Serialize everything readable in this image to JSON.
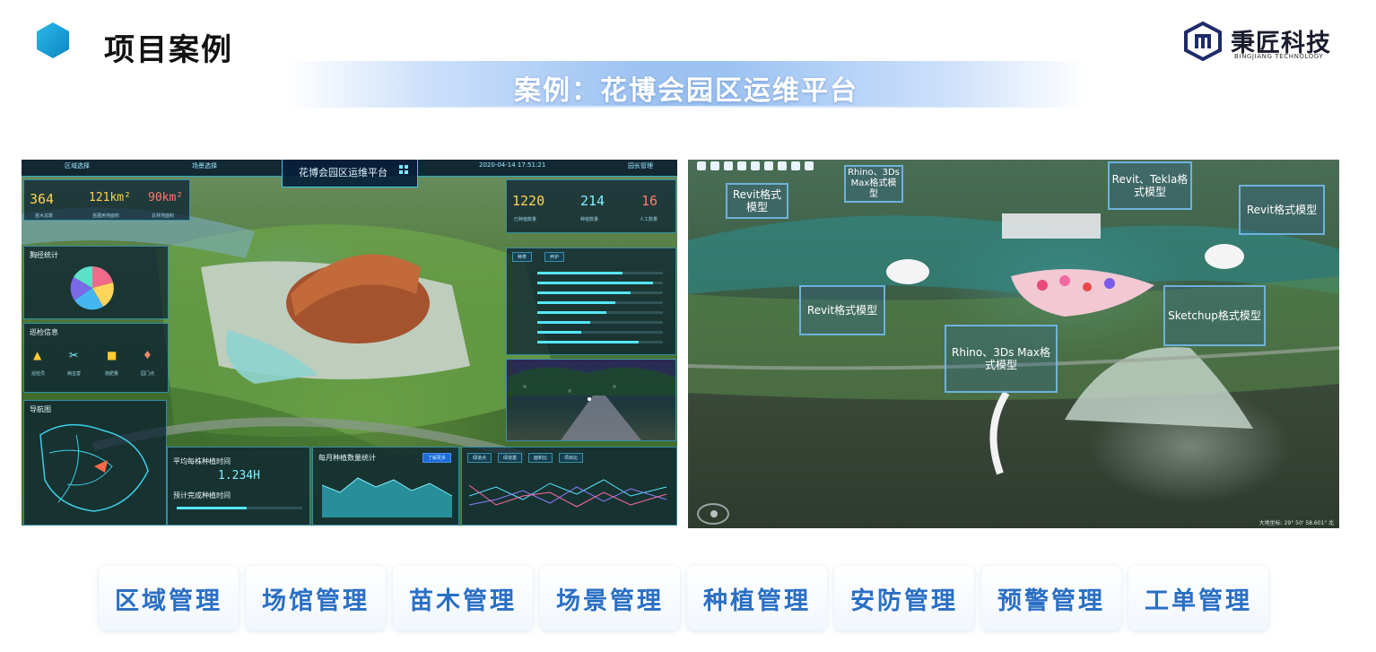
{
  "header": {
    "title": "项目案例",
    "logo_cn": "秉匠科技",
    "logo_en": "BINGJIANG TECHNOLOGY"
  },
  "banner": {
    "text": "案例：花博会园区运维平台"
  },
  "left_screen": {
    "topbar": {
      "item1": "区域选择",
      "item2": "场景选择",
      "datetime": "2020-04-14  17:51:21",
      "item4": "园长管理"
    },
    "center_title": "花博会园区运维平台",
    "stats_left": {
      "values": [
        "364",
        "121km²",
        "90km²"
      ],
      "labels": [
        "苗木总数",
        "苗圃用地面积",
        "总林地面积"
      ]
    },
    "stats_right": {
      "values": [
        "1220",
        "214",
        "16"
      ],
      "labels": [
        "已种植数量",
        "种植数量",
        "人工数量"
      ]
    },
    "pie_panel_title": "胸径统计",
    "inspect_panel_title": "巡检信息",
    "inspect_items": [
      "巡检员",
      "病虫害",
      "施肥量",
      "园门点"
    ],
    "nav_panel_title": "导航图",
    "avg_panel": {
      "title": "平均每株种植时间",
      "value": "1.234H",
      "subtitle": "预计完成种植时间"
    },
    "monthly_panel": {
      "title": "每月种植数量统计",
      "button": "了解更多"
    },
    "bottom_tabs": [
      "绿道点",
      "绿道基",
      "面积比",
      "项目比"
    ],
    "right_tabs": [
      "种类",
      "养护"
    ],
    "bars": [
      0.68,
      0.92,
      0.74,
      0.62,
      0.55,
      0.42,
      0.35,
      0.81
    ]
  },
  "right_screen": {
    "labels": [
      "Revit格式模型",
      "Rhino、3Ds Max格式模型",
      "Revit、Tekla格式模型",
      "Revit格式模型",
      "Revit格式模型",
      "Sketchup格式模型",
      "Rhino、3Ds Max格式模型"
    ],
    "coords": "大地坐标: 29° 50' 58.601\" 北"
  },
  "modules": [
    "区域管理",
    "场馆管理",
    "苗木管理",
    "场景管理",
    "种植管理",
    "安防管理",
    "预警管理",
    "工单管理"
  ],
  "colors": {
    "accent": "#2a6fc4",
    "banner": "#9cc2f2",
    "hex": "#1ba3d8"
  }
}
